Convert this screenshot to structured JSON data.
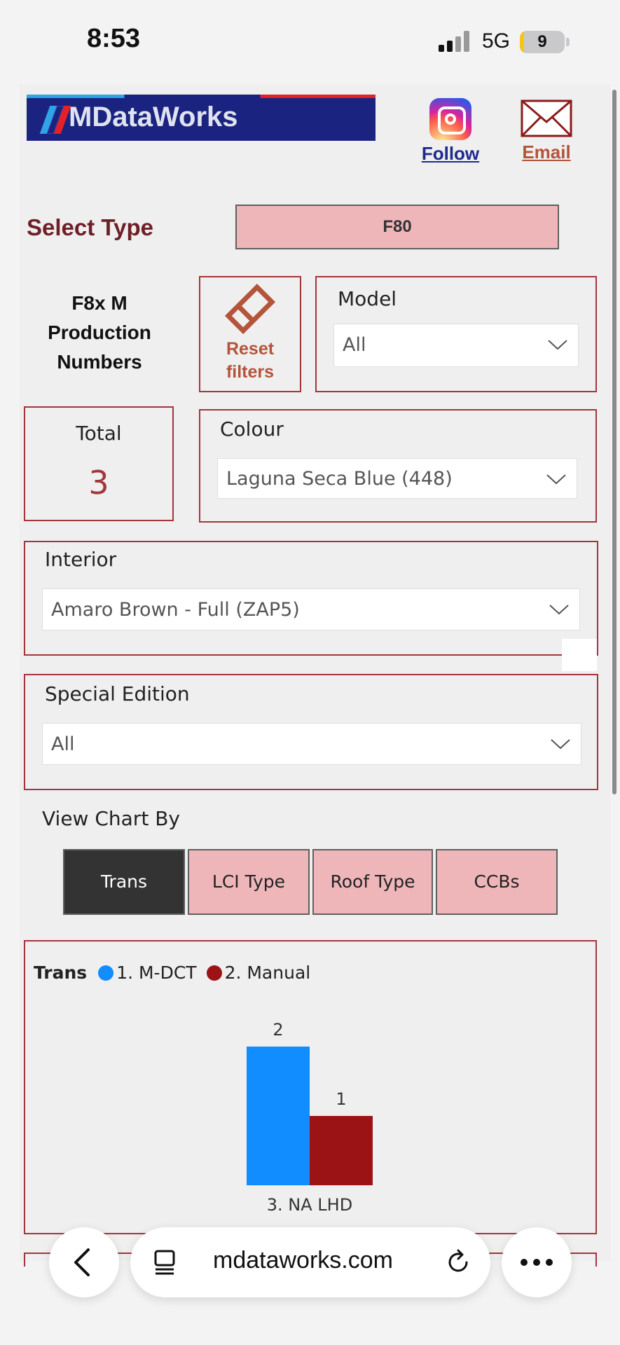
{
  "status_bar": {
    "time": "8:53",
    "network": "5G",
    "battery": "9",
    "battery_level": 0.09
  },
  "header": {
    "logo_text": "DataWorks",
    "follow_label": "Follow",
    "email_label": "Email",
    "colors": {
      "logo_bg": "#1b2380",
      "follow": "#1f2b8c",
      "email": "#b4543a"
    }
  },
  "type_selector": {
    "label": "Select Type",
    "selected": "F80"
  },
  "heading": {
    "line1": "F8x M",
    "line2": "Production",
    "line3": "Numbers"
  },
  "reset": {
    "line1": "Reset",
    "line2": "filters"
  },
  "filters": {
    "model": {
      "title": "Model",
      "value": "All"
    },
    "colour": {
      "title": "Colour",
      "value": "Laguna Seca Blue (448)"
    },
    "interior": {
      "title": "Interior",
      "value": "Amaro Brown - Full (ZAP5)"
    },
    "special_edition": {
      "title": "Special Edition",
      "value": "All"
    }
  },
  "total": {
    "label": "Total",
    "value": "3"
  },
  "view_chart_by": {
    "label": "View Chart By",
    "options": [
      "Trans",
      "LCI Type",
      "Roof Type",
      "CCBs"
    ],
    "active": "Trans"
  },
  "chart_data": {
    "type": "bar",
    "legend_title": "Trans",
    "categories": [
      "3. NA LHD"
    ],
    "series": [
      {
        "name": "1. M-DCT",
        "values": [
          2
        ],
        "color": "#118dff"
      },
      {
        "name": "2. Manual",
        "values": [
          1
        ],
        "color": "#9c1316"
      }
    ],
    "ylim": [
      0,
      2
    ],
    "legend_position": "top-left",
    "grid": false
  },
  "browser": {
    "url": "mdataworks.com"
  },
  "icons": [
    "instagram-icon",
    "email-icon",
    "eraser-icon",
    "chevron-down-icon",
    "back-icon",
    "tabs-icon",
    "reload-icon",
    "more-icon"
  ]
}
